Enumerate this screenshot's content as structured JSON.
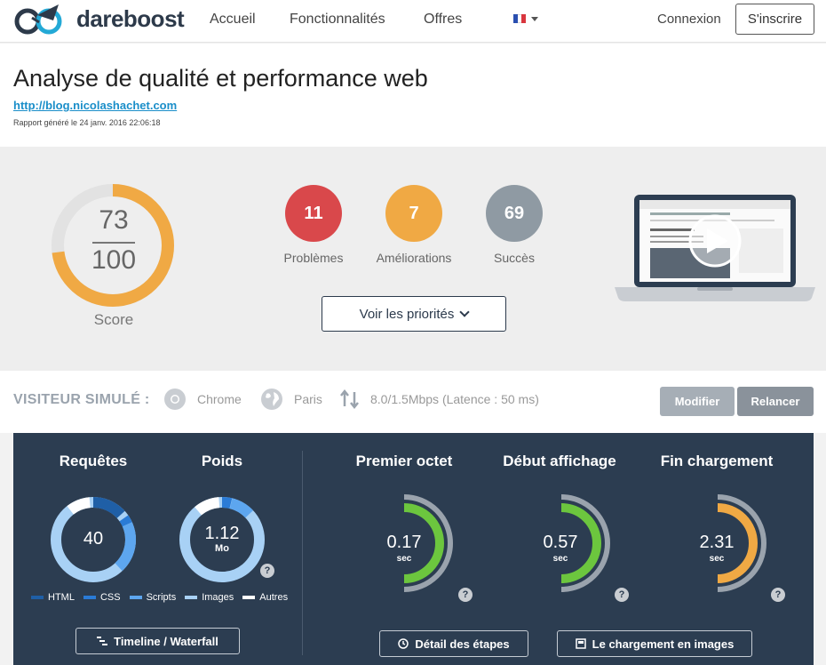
{
  "nav": {
    "brand": "dareboost",
    "links": [
      "Accueil",
      "Fonctionnalités",
      "Offres"
    ],
    "language_flag": "flag-fr-icon",
    "login": "Connexion",
    "signup": "S'inscrire"
  },
  "header": {
    "title": "Analyse de qualité et performance web",
    "url": "http://blog.nicolashachet.com",
    "report_date": "Rapport généré le 24 janv. 2016 22:06:18"
  },
  "score": {
    "value": "73",
    "max": "100",
    "label": "Score",
    "fraction": 0.73,
    "color": "#f0a944"
  },
  "counts": [
    {
      "value": "11",
      "label": "Problèmes",
      "color": "#d9484b"
    },
    {
      "value": "7",
      "label": "Améliorations",
      "color": "#f0a944"
    },
    {
      "value": "69",
      "label": "Succès",
      "color": "#8f9aa3"
    }
  ],
  "priorities_button": "Voir les priorités",
  "visitor": {
    "label": "VISITEUR SIMULÉ :",
    "browser": "Chrome",
    "location": "Paris",
    "connection": "8.0/1.5Mbps (Latence : 50 ms)",
    "modify": "Modifier",
    "restart": "Relancer"
  },
  "metrics": {
    "requests": {
      "title": "Requêtes",
      "value": "40"
    },
    "weight": {
      "title": "Poids",
      "value": "1.12",
      "unit": "Mo"
    },
    "legend": [
      {
        "label": "HTML",
        "color": "#1f5fa6"
      },
      {
        "label": "CSS",
        "color": "#2a7bd6"
      },
      {
        "label": "Scripts",
        "color": "#5da6ef"
      },
      {
        "label": "Images",
        "color": "#a8d1f5"
      },
      {
        "label": "Autres",
        "color": "#ffffff"
      }
    ],
    "timings": [
      {
        "title": "Premier octet",
        "value": "0.17",
        "unit": "sec",
        "color": "#6cc63e"
      },
      {
        "title": "Début affichage",
        "value": "0.57",
        "unit": "sec",
        "color": "#6cc63e"
      },
      {
        "title": "Fin chargement",
        "value": "2.31",
        "unit": "sec",
        "color": "#f0a944"
      }
    ],
    "timeline_button": "Timeline / Waterfall",
    "steps_button": "Détail des étapes",
    "images_button": "Le chargement en images"
  }
}
